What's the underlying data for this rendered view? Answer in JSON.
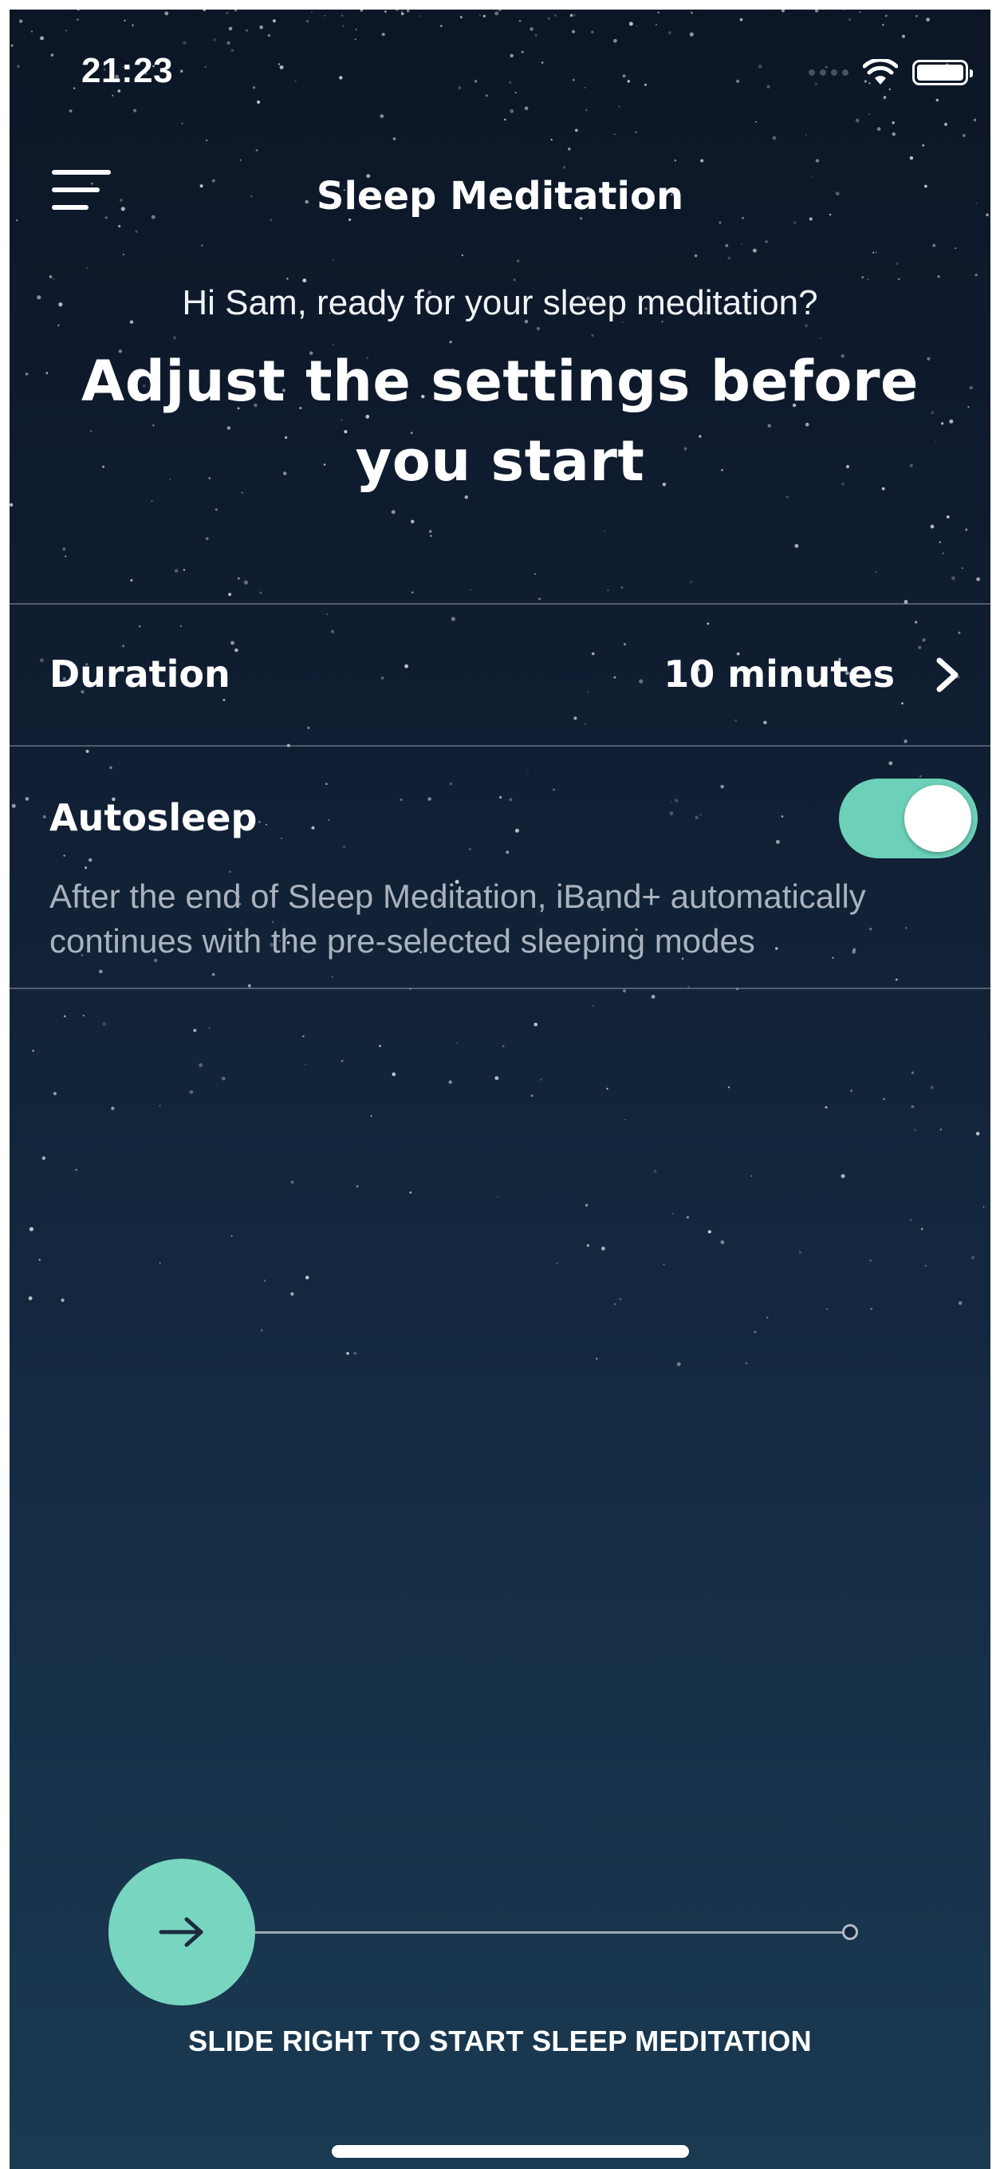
{
  "status_bar": {
    "time": "21:23"
  },
  "header": {
    "title": "Sleep Meditation",
    "menu_icon": "hamburger-menu-icon"
  },
  "intro": {
    "greeting": "Hi Sam, ready for your sleep meditation?",
    "headline": "Adjust the settings before you start"
  },
  "settings": {
    "duration": {
      "label": "Duration",
      "value": "10 minutes",
      "icon": "chevron-right-icon"
    },
    "autosleep": {
      "label": "Autosleep",
      "enabled": true,
      "description": "After the end of Sleep Meditation, iBand+ automatically continues with the pre-selected sleeping modes"
    }
  },
  "slider": {
    "label": "SLIDE RIGHT TO START SLEEP MEDITATION",
    "handle_icon": "arrow-right-icon"
  },
  "colors": {
    "accent": "#6cd1b8",
    "background_top": "#0c1626",
    "background_bottom": "#1a3a52",
    "secondary_text": "#aab2bd"
  }
}
